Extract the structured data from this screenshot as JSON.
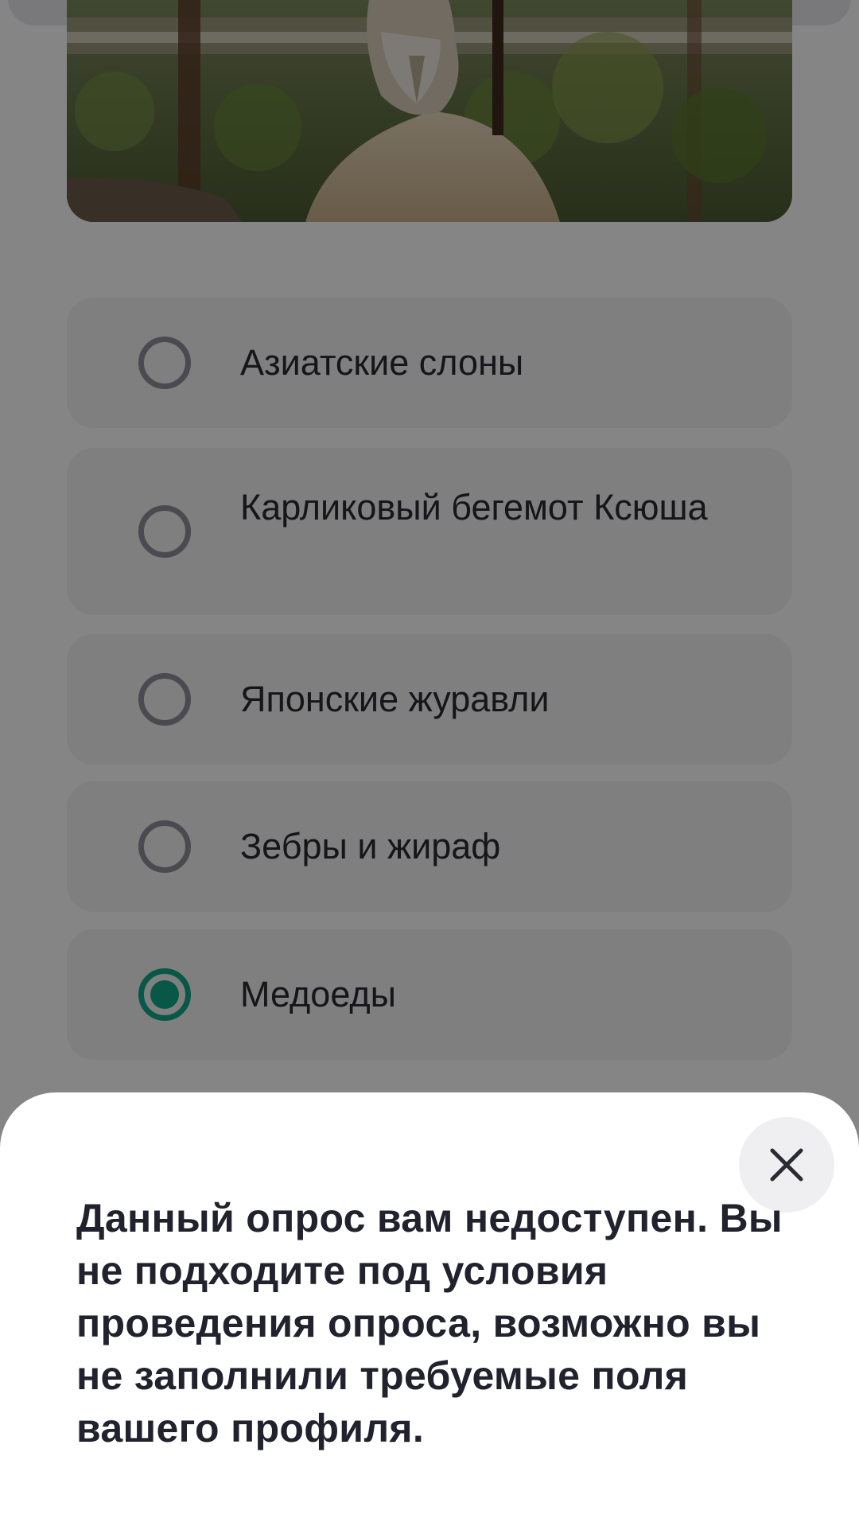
{
  "survey": {
    "options": [
      {
        "label": "Азиатские слоны",
        "selected": false
      },
      {
        "label": "Карликовый бегемот Ксюша",
        "selected": false
      },
      {
        "label": "Японские журавли",
        "selected": false
      },
      {
        "label": "Зебры и жираф",
        "selected": false
      },
      {
        "label": "Медоеды",
        "selected": true
      }
    ],
    "photo_icon": "meerkat-photo"
  },
  "dialog": {
    "message": "Данный опрос вам недоступен. Вы не подходите под условия проведения опроса, возможно вы не заполнили требуемые поля вашего профиля.",
    "close_icon": "close-icon"
  },
  "colors": {
    "accent": "#12a888",
    "radio_unselected": "#8e8f9a",
    "option_background": "#f4f4f6",
    "text": "#2a2a33"
  }
}
